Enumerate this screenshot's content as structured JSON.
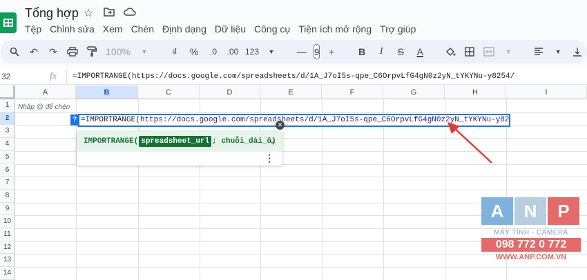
{
  "doc": {
    "title": "Tổng hợp"
  },
  "menu": [
    "Tệp",
    "Chỉnh sửa",
    "Xem",
    "Chèn",
    "Định dạng",
    "Dữ liệu",
    "Công cụ",
    "Tiện ích mở rộng",
    "Trợ giúp"
  ],
  "toolbar": {
    "zoom": "100%",
    "currency": "₫",
    "percent": "%",
    "dec_decrease": ".0",
    "dec_increase": ".00",
    "number_format": "123",
    "font_size": "9",
    "bold": "B",
    "italic": "I",
    "strike": "S",
    "text_color": "A"
  },
  "formula_bar": {
    "cell_ref": "32",
    "fx": "fx",
    "formula": "=IMPORTRANGE(https://docs.google.com/spreadsheets/d/1A_J7oI5s-qpe_C6OrpvLfG4gN0z2yN_tYKYNu-y8254/_"
  },
  "grid": {
    "columns": [
      "A",
      "B",
      "C",
      "D",
      "E",
      "F",
      "G",
      "H",
      "I"
    ],
    "rows": [
      "1",
      "2",
      "3",
      "4",
      "5",
      "6",
      "7",
      "8",
      "9",
      "10",
      "11",
      "12",
      "13",
      "14"
    ]
  },
  "cell_hint": "Nhập @ để chèn",
  "cell_editor": {
    "prefix": "=IMPORTRANGE(",
    "url": "https://docs.google.com/spreadsheets/d/1A_J7oI5s-qpe_C6OrpvLfG4gN0z2yN_tYKYNu-y8254/",
    "help_badge": "?"
  },
  "autocomplete": {
    "func": "IMPORTRANGE(",
    "param1": "spreadsheet_url",
    "rest": "; chuỗi_dải_ô)"
  },
  "watermark": {
    "letters": [
      "A",
      "N",
      "P"
    ],
    "subtitle": "MÁY TÍNH - CAMERA",
    "phone": "098 772 0 772",
    "website": "WWW.ANP.COM.VN"
  },
  "colors": {
    "accent": "#1a73e8",
    "arrow": "#e53935",
    "popup_green": "#137333"
  }
}
